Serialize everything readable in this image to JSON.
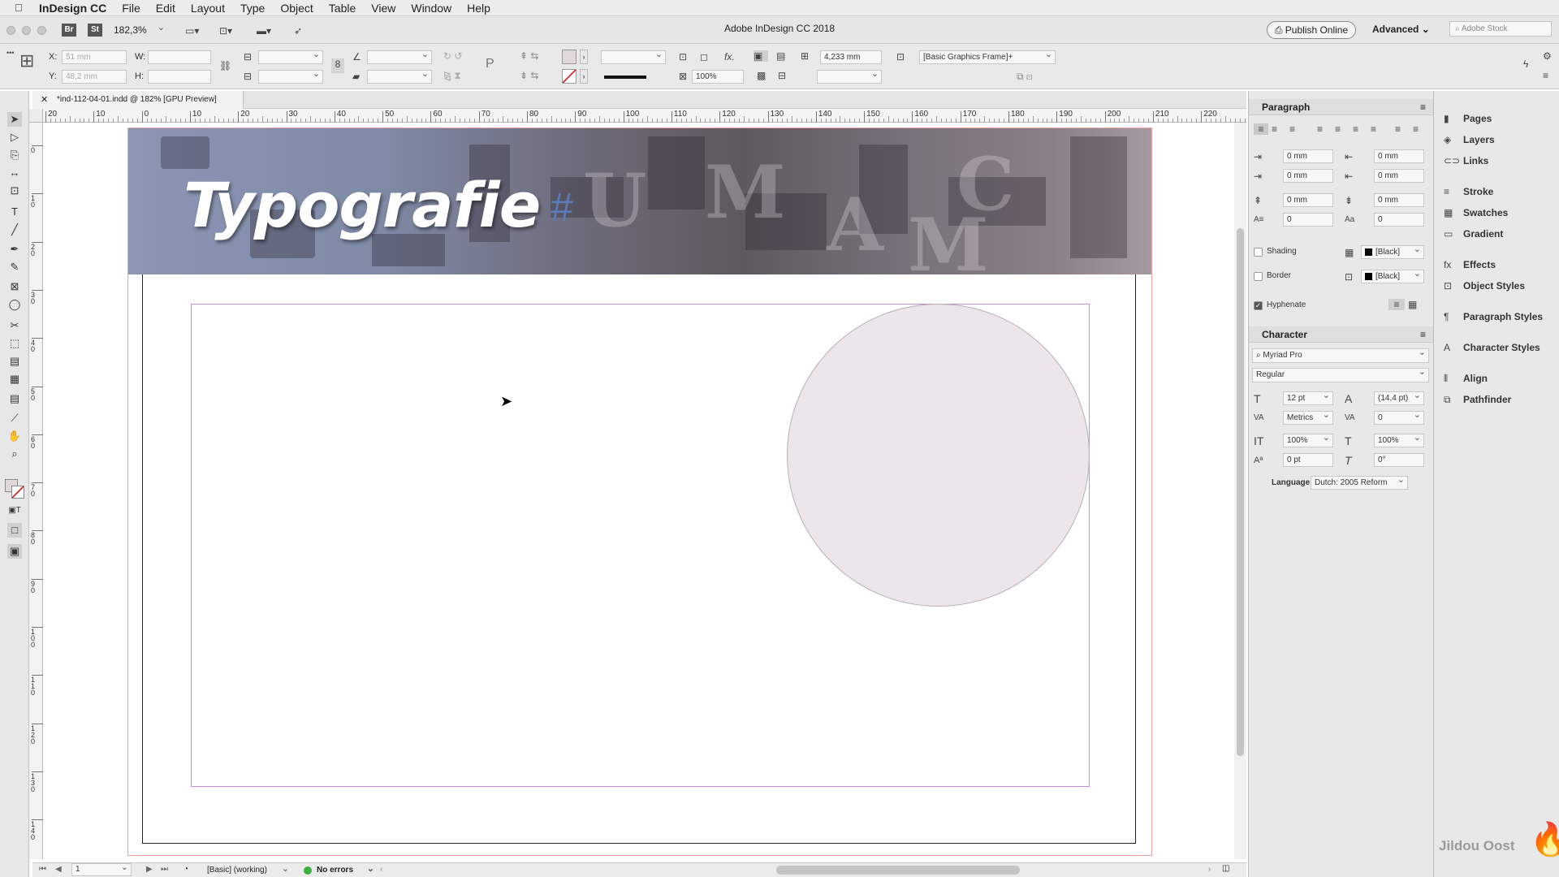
{
  "menubar": {
    "app": "InDesign CC",
    "items": [
      "File",
      "Edit",
      "Layout",
      "Type",
      "Object",
      "Table",
      "View",
      "Window",
      "Help"
    ]
  },
  "titlebar": {
    "title": "Adobe InDesign CC 2018",
    "bridge": "Br",
    "stock": "St",
    "zoom": "182,3%",
    "publish": "Publish Online",
    "workspace": "Advanced",
    "search_placeholder": "Adobe Stock"
  },
  "control": {
    "x_label": "X:",
    "x": "51 mm",
    "y_label": "Y:",
    "y": "48,2 mm",
    "w_label": "W:",
    "h_label": "H:",
    "stroke_weight": "4,233 mm",
    "opacity": "100%",
    "object_style": "[Basic Graphics Frame]+"
  },
  "document": {
    "tab": "*ind-112-04-01.indd @ 182% [GPU Preview]",
    "heading": "Typografie",
    "ruler_ticks": [
      "20",
      "10",
      "0",
      "10",
      "20",
      "30",
      "40",
      "50",
      "60",
      "70",
      "80",
      "90",
      "100",
      "110",
      "120",
      "130",
      "140",
      "150",
      "160",
      "170",
      "180",
      "190",
      "200",
      "210",
      "220"
    ],
    "vruler_ticks": [
      "0",
      "1 0",
      "2 0",
      "3 0",
      "4 0",
      "5 0",
      "6 0",
      "7 0",
      "8 0",
      "9 0",
      "1 0 0",
      "1 1 0",
      "1 2 0",
      "1 3 0",
      "1 4 0"
    ]
  },
  "status": {
    "page": "1",
    "style": "[Basic] (working)",
    "errors": "No errors"
  },
  "paragraph": {
    "title": "Paragraph",
    "left_indent": "0 mm",
    "right_indent": "0 mm",
    "first_line": "0 mm",
    "last_line": "0 mm",
    "space_before": "0 mm",
    "space_after": "0 mm",
    "drop_lines": "0",
    "drop_chars": "0",
    "shading_label": "Shading",
    "shading_color": "[Black]",
    "border_label": "Border",
    "border_color": "[Black]",
    "hyphenate_label": "Hyphenate"
  },
  "character": {
    "title": "Character",
    "font": "Myriad Pro",
    "style": "Regular",
    "size": "12 pt",
    "leading": "(14,4 pt)",
    "kerning": "Metrics",
    "tracking": "0",
    "vscale": "100%",
    "hscale": "100%",
    "baseline": "0 pt",
    "skew": "0°",
    "language_label": "Language:",
    "language": "Dutch: 2005 Reform"
  },
  "dock": {
    "items": [
      {
        "label": "Pages",
        "icon": "pages-icon",
        "glyph": "▮"
      },
      {
        "label": "Layers",
        "icon": "layers-icon",
        "glyph": "◈"
      },
      {
        "label": "Links",
        "icon": "links-icon",
        "glyph": "⊂⊃"
      },
      {
        "label": "Stroke",
        "icon": "stroke-icon",
        "glyph": "≡"
      },
      {
        "label": "Swatches",
        "icon": "swatches-icon",
        "glyph": "▦"
      },
      {
        "label": "Gradient",
        "icon": "gradient-icon",
        "glyph": "▭"
      },
      {
        "label": "Effects",
        "icon": "effects-icon",
        "glyph": "fx"
      },
      {
        "label": "Object Styles",
        "icon": "object-styles-icon",
        "glyph": "⊡"
      },
      {
        "label": "Paragraph Styles",
        "icon": "paragraph-styles-icon",
        "glyph": "¶"
      },
      {
        "label": "Character Styles",
        "icon": "character-styles-icon",
        "glyph": "A"
      },
      {
        "label": "Align",
        "icon": "align-icon",
        "glyph": "⫴"
      },
      {
        "label": "Pathfinder",
        "icon": "pathfinder-icon",
        "glyph": "⧉"
      }
    ],
    "watermark": "Jildou Oost"
  },
  "colors": {
    "margin_guide": "#c98ad6",
    "bleed_guide": "#f1a5a5",
    "circle_fill": "#ece6ea",
    "header_image": "#6e7a94"
  }
}
